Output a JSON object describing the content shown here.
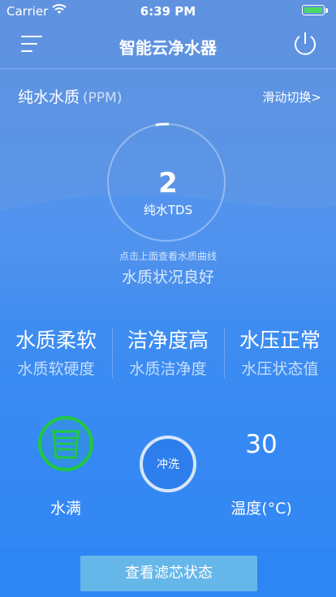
{
  "status_bar": {
    "carrier": "Carrier",
    "time": "6:39 PM",
    "wifi_icon": "wifi-icon",
    "battery_icon": "battery-icon",
    "battery_color": "#4cd964"
  },
  "nav": {
    "title": "智能云净水器",
    "menu_icon": "menu-icon",
    "power_icon": "power-icon"
  },
  "quality": {
    "title": "纯水水质",
    "unit": "(PPM)",
    "switch_label": "滑动切换>"
  },
  "gauge": {
    "value": "2",
    "label": "纯水TDS",
    "hint": "点击上面查看水质曲线",
    "status": "水质状况良好"
  },
  "metrics": [
    {
      "value": "水质柔软",
      "label": "水质软硬度"
    },
    {
      "value": "洁净度高",
      "label": "水质洁净度"
    },
    {
      "value": "水压正常",
      "label": "水压状态值"
    }
  ],
  "tank": {
    "icon": "water-tank-icon",
    "label": "水满",
    "color": "#1fc93f"
  },
  "flush": {
    "label": "冲洗"
  },
  "temperature": {
    "value": "30",
    "label": "温度(°C)"
  },
  "footer": {
    "filter_button": "查看滤芯状态"
  },
  "colors": {
    "top_bg": "#5f92df",
    "bottom_bg": "#2f86f4",
    "button_bg": "#66b7e9"
  }
}
